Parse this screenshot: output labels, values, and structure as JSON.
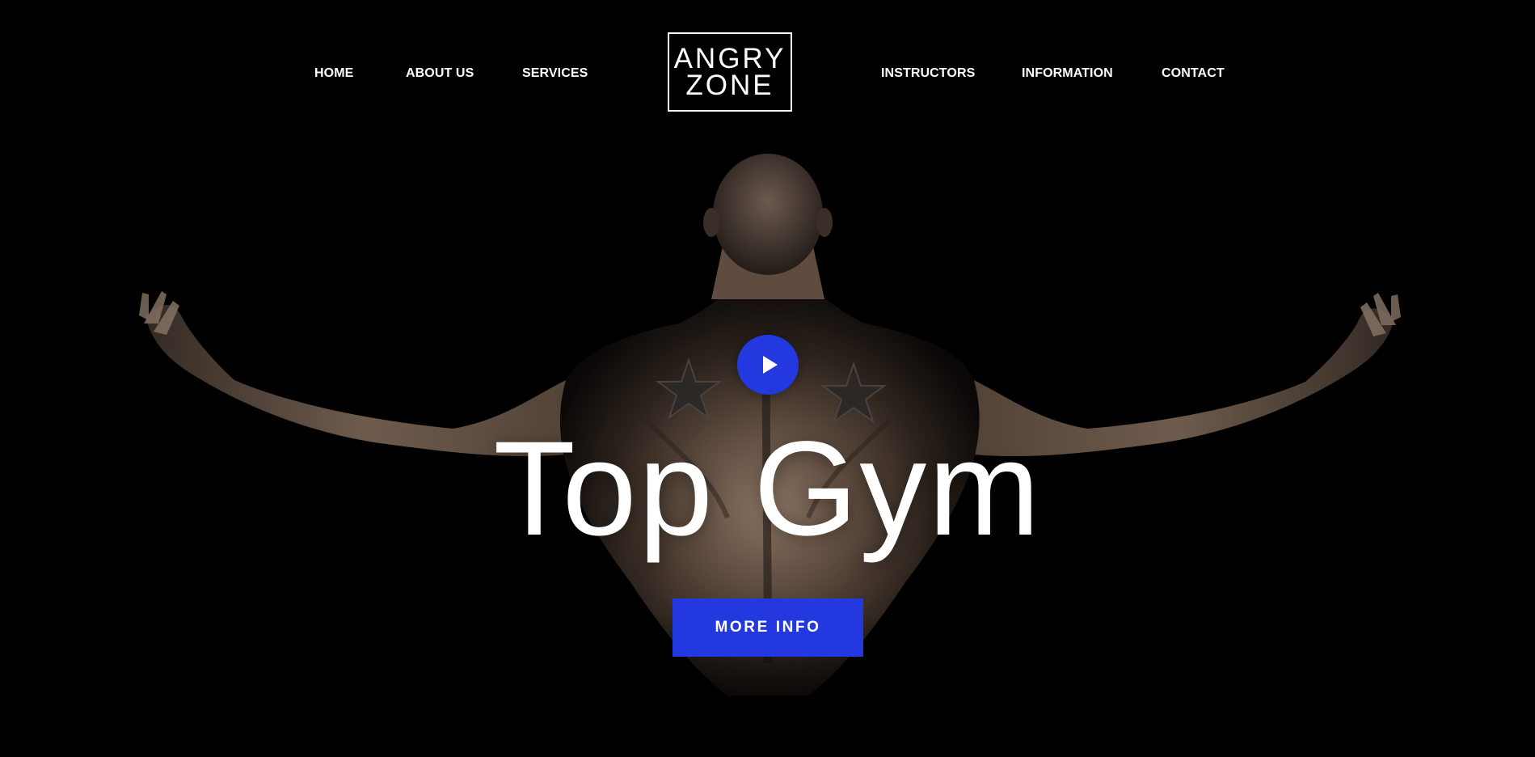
{
  "nav": {
    "left_links": [
      {
        "label": "HOME"
      },
      {
        "label": "ABOUT US"
      },
      {
        "label": "SERVICES"
      }
    ],
    "right_links": [
      {
        "label": "INSTRUCTORS"
      },
      {
        "label": "INFORMATION"
      },
      {
        "label": "CONTACT"
      }
    ],
    "logo": {
      "line1": "ANGRY",
      "line2": "ZONE"
    }
  },
  "hero": {
    "headline": "Top Gym",
    "cta_label": "MORE INFO",
    "play_button_icon": "play-icon"
  },
  "colors": {
    "background": "#000000",
    "accent": "#2438e0",
    "text": "#ffffff"
  }
}
